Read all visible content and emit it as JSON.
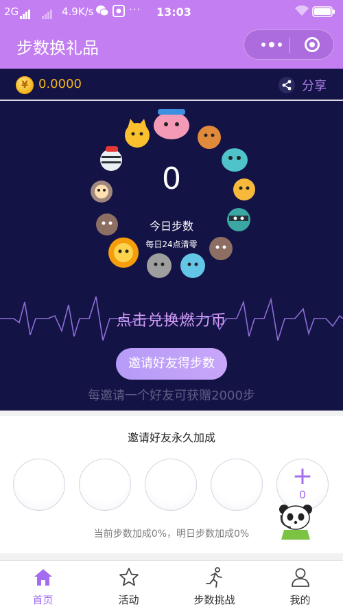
{
  "status_bar": {
    "network": "2G",
    "speed": "4.9K/s",
    "dots": "···",
    "time": "13:03"
  },
  "header": {
    "title": "步数换礼品"
  },
  "wallet": {
    "balance": "0.0000",
    "coin_symbol": "¥",
    "share_label": "分享"
  },
  "steps": {
    "value": "0",
    "label": "今日步数",
    "reset_note": "每日24点清零"
  },
  "exchange": {
    "label": "点击兑换燃力币"
  },
  "invite": {
    "button_label": "邀请好友得步数",
    "tip": "每邀请一个好友可获赠2000步"
  },
  "bonus": {
    "title": "邀请好友永久加成",
    "add_symbol": "+",
    "invited_count": "0",
    "note": "当前步数加成0%，明日步数加成0%"
  },
  "tabs": [
    {
      "label": "首页",
      "icon": "home-icon",
      "active": true
    },
    {
      "label": "活动",
      "icon": "star-icon",
      "active": false
    },
    {
      "label": "步数挑战",
      "icon": "runner-icon",
      "active": false
    },
    {
      "label": "我的",
      "icon": "user-icon",
      "active": false
    }
  ],
  "colors": {
    "header": "#c37ef1",
    "dark_bg": "#141346",
    "accent": "#a46df0",
    "gold": "#f5b71f"
  }
}
